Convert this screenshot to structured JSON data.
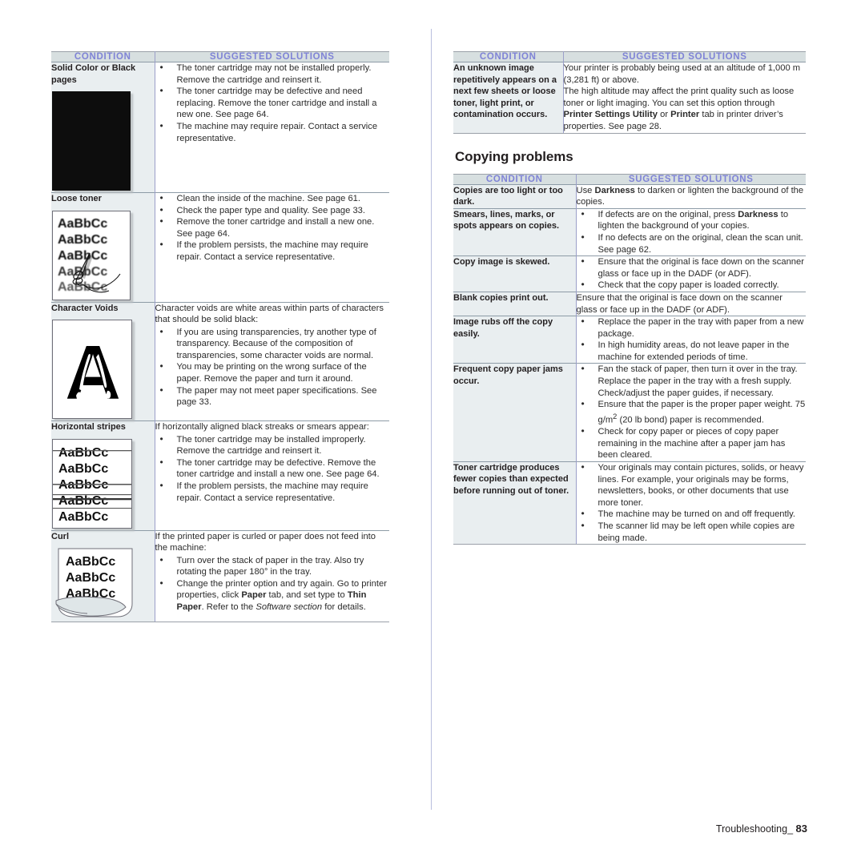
{
  "document": {
    "footer_label": "Troubleshooting_",
    "footer_page": "83"
  },
  "left_column": {
    "table": {
      "headers": {
        "condition": "CONDITION",
        "solutions": "SUGGESTED SOLUTIONS"
      },
      "rows": [
        {
          "condition": "Solid Color or Black pages",
          "sample": "solid-black-page",
          "intro": "",
          "bullets": [
            "The toner cartridge may not be installed properly. Remove the cartridge and reinsert it.",
            "The toner cartridge may be defective and need replacing. Remove the toner cartridge and install a new one. See page 64.",
            "The machine may require repair. Contact a service representative."
          ]
        },
        {
          "condition": "Loose toner",
          "sample": "loose-toner-page",
          "intro": "",
          "bullets": [
            "Clean the inside of the machine. See page 61.",
            "Check the paper type and quality. See page 33.",
            "Remove the toner cartridge and install a new one. See page 64.",
            "If the problem persists, the machine may require repair. Contact a service representative."
          ]
        },
        {
          "condition": "Character Voids",
          "sample": "character-voids-page",
          "intro": "Character voids are white areas within parts of characters that should be solid black:",
          "bullets": [
            "If you are using transparencies, try another type of transparency. Because of the composition of transparencies, some character voids are normal.",
            "You may be printing on the wrong surface of the paper. Remove the paper and turn it around.",
            "The paper may not meet paper specifications. See page 33."
          ]
        },
        {
          "condition": "Horizontal stripes",
          "sample": "horizontal-stripes-page",
          "intro": "If horizontally aligned black streaks or smears appear:",
          "bullets": [
            "The toner cartridge may be installed improperly. Remove the cartridge and reinsert it.",
            "The toner cartridge may be defective. Remove the toner cartridge and install a new one. See page 64.",
            "If the problem persists, the machine may require repair. Contact a service representative."
          ]
        },
        {
          "condition": "Curl",
          "sample": "curl-page",
          "intro": "If the printed paper is curled or paper does not feed into the machine:",
          "bullets": [
            "Turn over the stack of paper in the tray. Also try rotating the paper 180° in the tray.",
            "Change the printer option and try again. Go to printer properties, click <b>Paper</b> tab, and set type to <b>Thin Paper</b>. Refer to the <i>Software section</i> for details."
          ]
        }
      ]
    },
    "sample_text_line": "AaBbCc"
  },
  "right_column": {
    "table_top": {
      "headers": {
        "condition": "CONDITION",
        "solutions": "SUGGESTED SOLUTIONS"
      },
      "rows": [
        {
          "condition": "An unknown image repetitively appears on a next few sheets or loose toner, light print, or contamination occurs.",
          "paragraph": "Your printer is probably being used at an altitude of 1,000 m (3,281 ft) or above.<br>The high altitude may affect the print quality such as loose toner or light imaging. You can set this option through <b>Printer Settings Utility</b> or <b>Printer</b> tab in printer driver’s properties. See page 28."
        }
      ]
    },
    "section_heading": "Copying problems",
    "table_copying": {
      "headers": {
        "condition": "CONDITION",
        "solutions": "SUGGESTED SOLUTIONS"
      },
      "rows": [
        {
          "condition": "Copies are too light or too dark.",
          "paragraph": "Use <b>Darkness</b> to darken or lighten the background of the copies.",
          "bullets": []
        },
        {
          "condition": "Smears, lines, marks, or spots appears on copies.",
          "paragraph": "",
          "bullets": [
            "If defects are on the original, press <b>Darkness</b> to lighten the background of your copies.",
            "If no defects are on the original, clean the scan unit. See page 62."
          ]
        },
        {
          "condition": "Copy image is skewed.",
          "paragraph": "",
          "bullets": [
            "Ensure that the original is face down on the scanner glass or face up in the DADF (or ADF).",
            "Check that the copy paper is loaded correctly."
          ]
        },
        {
          "condition": "Blank copies print out.",
          "paragraph": "Ensure that the original is face down on the scanner glass or face up in the DADF (or ADF).",
          "bullets": []
        },
        {
          "condition": "Image rubs off the copy easily.",
          "paragraph": "",
          "bullets": [
            "Replace the paper in the tray with paper from a new package.",
            "In high humidity areas, do not leave paper in the machine for extended periods of time."
          ]
        },
        {
          "condition": "Frequent copy paper jams occur.",
          "paragraph": "",
          "bullets": [
            "Fan the stack of paper, then turn it over in the tray. Replace the paper in the tray with a fresh supply. Check/adjust the paper guides, if necessary.",
            "Ensure that the paper is the proper paper weight. 75 g/m<sup>2</sup> (20 lb bond) paper is recommended.",
            "Check for copy paper or pieces of copy paper remaining in the machine after a paper jam has been cleared."
          ]
        },
        {
          "condition": "Toner cartridge produces fewer copies than expected before running out of toner.",
          "paragraph": "",
          "bullets": [
            "Your originals may contain pictures, solids, or heavy lines. For example, your originals may be forms, newsletters, books, or other documents that use more toner.",
            "The machine may be turned on and off frequently.",
            "The scanner lid may be left open while copies are being made."
          ]
        }
      ]
    }
  },
  "colors": {
    "header_background": "#d7dfe0",
    "header_text": "#7f83d6",
    "condition_background": "#e9eef0",
    "rule": "#8d9ba6",
    "divider": "#9b9fc9",
    "body_text": "#2b2b2b"
  }
}
